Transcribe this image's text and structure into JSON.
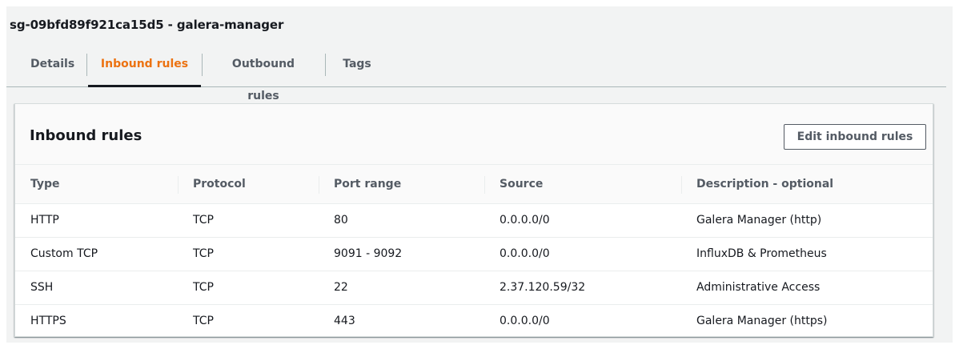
{
  "security_group": {
    "title": "sg-09bfd89f921ca15d5 - galera-manager"
  },
  "tabs": [
    {
      "label": "Details"
    },
    {
      "label": "Inbound rules",
      "active": true
    },
    {
      "label": "Outbound rules"
    },
    {
      "label": "Tags"
    }
  ],
  "panel": {
    "title": "Inbound rules",
    "edit_button_label": "Edit inbound rules"
  },
  "table": {
    "columns": [
      "Type",
      "Protocol",
      "Port range",
      "Source",
      "Description - optional"
    ],
    "rows": [
      [
        "HTTP",
        "TCP",
        "80",
        "0.0.0.0/0",
        "Galera Manager (http)"
      ],
      [
        "Custom TCP",
        "TCP",
        "9091 - 9092",
        "0.0.0.0/0",
        "InfluxDB & Prometheus"
      ],
      [
        "SSH",
        "TCP",
        "22",
        "2.37.120.59/32",
        "Administrative Access"
      ],
      [
        "HTTPS",
        "TCP",
        "443",
        "0.0.0.0/0",
        "Galera Manager (https)"
      ]
    ]
  },
  "colors": {
    "active_tab": "#ec7211",
    "text": "#16191f",
    "muted_text": "#545b64",
    "background": "#f2f3f3"
  }
}
